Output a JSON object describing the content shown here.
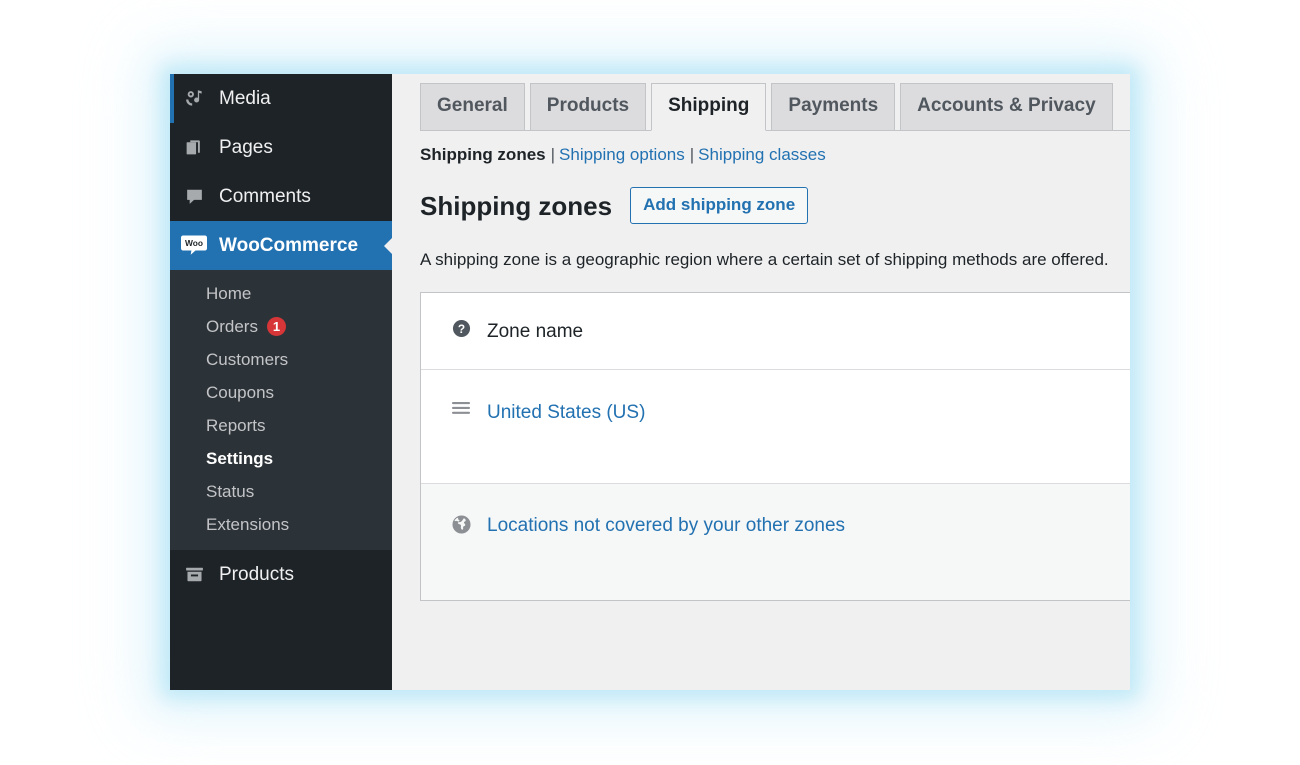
{
  "sidebar": {
    "top_items": [
      {
        "label": "Media",
        "icon": "media-icon"
      },
      {
        "label": "Pages",
        "icon": "pages-icon"
      },
      {
        "label": "Comments",
        "icon": "comments-icon"
      }
    ],
    "current_item": {
      "label": "WooCommerce",
      "icon": "woocommerce-icon"
    },
    "submenu": [
      {
        "label": "Home",
        "badge": null,
        "active": false
      },
      {
        "label": "Orders",
        "badge": "1",
        "active": false
      },
      {
        "label": "Customers",
        "badge": null,
        "active": false
      },
      {
        "label": "Coupons",
        "badge": null,
        "active": false
      },
      {
        "label": "Reports",
        "badge": null,
        "active": false
      },
      {
        "label": "Settings",
        "badge": null,
        "active": true
      },
      {
        "label": "Status",
        "badge": null,
        "active": false
      },
      {
        "label": "Extensions",
        "badge": null,
        "active": false
      }
    ],
    "bottom_items": [
      {
        "label": "Products",
        "icon": "products-icon"
      }
    ]
  },
  "tabs": [
    {
      "label": "General",
      "active": false
    },
    {
      "label": "Products",
      "active": false
    },
    {
      "label": "Shipping",
      "active": true
    },
    {
      "label": "Payments",
      "active": false
    },
    {
      "label": "Accounts & Privacy",
      "active": false
    }
  ],
  "subnav": {
    "current": "Shipping zones",
    "separator": "|",
    "links": [
      "Shipping options",
      "Shipping classes"
    ]
  },
  "page": {
    "title": "Shipping zones",
    "add_button": "Add shipping zone",
    "description": "A shipping zone is a geographic region where a certain set of shipping methods are offered."
  },
  "table": {
    "columns": [
      "Zone name"
    ],
    "help_icon": "help-icon",
    "rows": [
      {
        "icon": "drag-handle-icon",
        "name": "United States (US)",
        "is_link": true,
        "variant": "zone"
      },
      {
        "icon": "globe-icon",
        "name": "Locations not covered by your other zones",
        "is_link": true,
        "variant": "rest-of-world"
      }
    ]
  },
  "colors": {
    "sidebar_bg": "#1d2327",
    "submenu_bg": "#2c3338",
    "accent_blue": "#2271b1",
    "badge_red": "#d63638",
    "content_bg": "#f0f0f1"
  }
}
